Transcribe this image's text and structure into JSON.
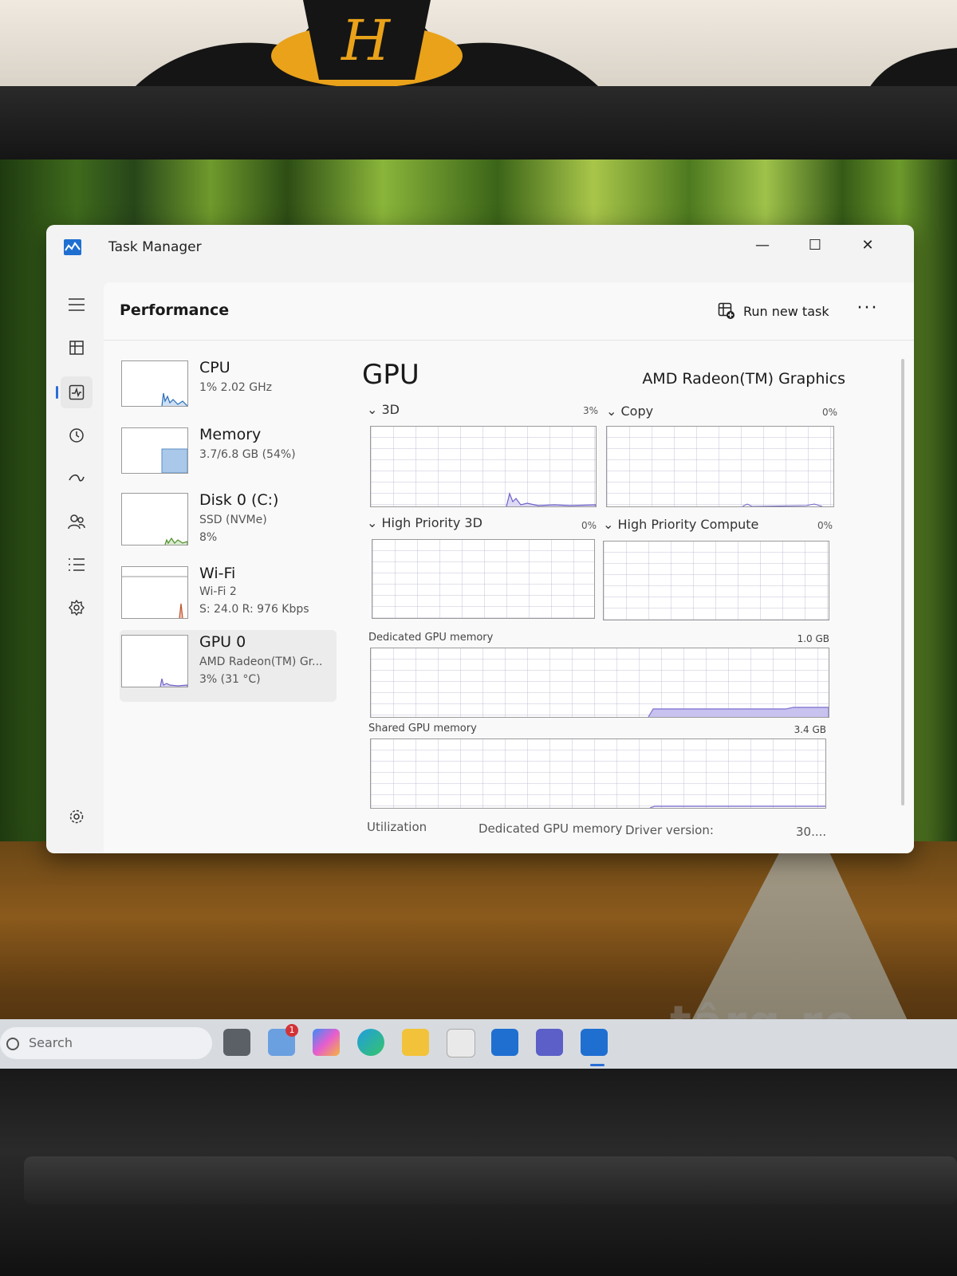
{
  "window": {
    "title": "Task Manager",
    "controls": {
      "minimize": "—",
      "maximize": "☐",
      "close": "✕"
    }
  },
  "header": {
    "page_title": "Performance",
    "run_new_task": "Run new task",
    "more": "···"
  },
  "sidebar": {
    "items": [
      {
        "name": "menu-icon",
        "active": false
      },
      {
        "name": "processes-icon",
        "active": false
      },
      {
        "name": "performance-icon",
        "active": true
      },
      {
        "name": "app-history-icon",
        "active": false
      },
      {
        "name": "startup-apps-icon",
        "active": false
      },
      {
        "name": "users-icon",
        "active": false
      },
      {
        "name": "details-icon",
        "active": false
      },
      {
        "name": "services-icon",
        "active": false
      },
      {
        "name": "settings-icon",
        "active": false
      }
    ]
  },
  "resources": [
    {
      "name": "CPU",
      "line1": "1% 2.02 GHz",
      "line2": "",
      "line3": "",
      "selected": false
    },
    {
      "name": "Memory",
      "line1": "3.7/6.8 GB (54%)",
      "line2": "",
      "line3": "",
      "selected": false
    },
    {
      "name": "Disk 0 (C:)",
      "line1": "SSD (NVMe)",
      "line2": "8%",
      "line3": "",
      "selected": false
    },
    {
      "name": "Wi-Fi",
      "line1": "Wi-Fi 2",
      "line2": "S: 24.0 R: 976 Kbps",
      "line3": "",
      "selected": false
    },
    {
      "name": "GPU 0",
      "line1": "AMD Radeon(TM) Gr...",
      "line2": "3% (31 °C)",
      "line3": "",
      "selected": true
    }
  ],
  "detail": {
    "title": "GPU",
    "model": "AMD Radeon(TM) Graphics",
    "engines": [
      {
        "label": "3D",
        "pct": "3%"
      },
      {
        "label": "Copy",
        "pct": "0%"
      },
      {
        "label": "High Priority 3D",
        "pct": "0%"
      },
      {
        "label": "High Priority Compute",
        "pct": "0%"
      }
    ],
    "dedicated": {
      "label": "Dedicated GPU memory",
      "cap": "1.0 GB"
    },
    "shared": {
      "label": "Shared GPU memory",
      "cap": "3.4 GB"
    },
    "stats": {
      "utilization": "Utilization",
      "dedicated": "Dedicated GPU memory",
      "driver": "Driver version:",
      "driver_value": "30...."
    }
  },
  "taskbar": {
    "search_placeholder": "Search",
    "notification_badge": "1"
  },
  "watermarks": [
    "târg.ro",
    "târg.ro",
    "târg.ro"
  ],
  "colors": {
    "accent": "#2a6ed6",
    "graph_line": "#8a7fd6",
    "graph_fill": "#c8c2ef",
    "memory_fill": "#a9c8ea"
  }
}
